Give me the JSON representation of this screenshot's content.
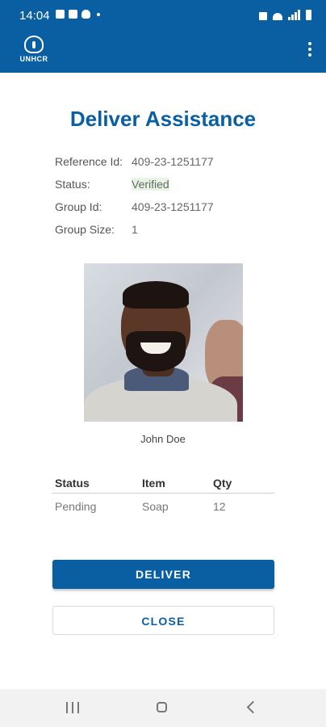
{
  "status_bar": {
    "time": "14:04"
  },
  "app_bar": {
    "logo_text": "UNHCR"
  },
  "page": {
    "title": "Deliver Assistance"
  },
  "details": [
    {
      "label": "Reference Id:",
      "value": "409-23-1251177"
    },
    {
      "label": "Status:",
      "value": "Verified"
    },
    {
      "label": "Group Id:",
      "value": "409-23-1251177"
    },
    {
      "label": "Group Size:",
      "value": "1"
    }
  ],
  "person": {
    "name": "John Doe"
  },
  "table": {
    "headers": [
      "Status",
      "Item",
      "Qty"
    ],
    "rows": [
      [
        "Pending",
        "Soap",
        "12"
      ]
    ]
  },
  "buttons": {
    "deliver": "DELIVER",
    "close": "CLOSE"
  },
  "colors": {
    "primary": "#0a5fa3",
    "verified_highlight": "#e7f6e4"
  },
  "icons": [
    "gallery-icon",
    "calendar-icon",
    "lightbulb-icon",
    "mute-icon",
    "wifi-icon",
    "signal-icon",
    "battery-icon",
    "more-vert-icon",
    "recents-icon",
    "home-icon",
    "back-icon"
  ]
}
